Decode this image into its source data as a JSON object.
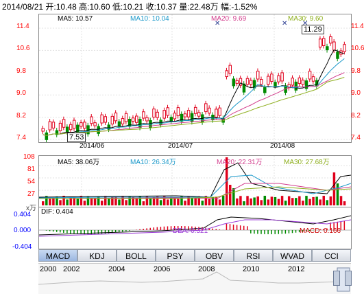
{
  "header": {
    "date": "2014/08/21",
    "open_label": "开:",
    "open": "10.48",
    "high_label": "高:",
    "high": "10.60",
    "low_label": "低:",
    "low": "10.21",
    "close_label": "收:",
    "close": "10.37",
    "vol_label": "量:",
    "vol": "22.48万",
    "chg_label": "幅:",
    "chg": "-1.52%"
  },
  "ma": {
    "ma5": "MA5: 10.57",
    "ma10": "MA10: 10.04",
    "ma20": "MA20: 9.69",
    "ma30": "MA30: 9.60",
    "colors": {
      "ma5": "#000000",
      "ma10": "#1a98c9",
      "ma20": "#d23c8c",
      "ma30": "#8dae1c"
    }
  },
  "price_axis": {
    "left": [
      "11.4",
      "10.6",
      "9.8",
      "9.0",
      "8.2",
      "7.4"
    ],
    "right": [
      "11.4",
      "10.6",
      "9.8",
      "9.0",
      "8.2",
      "7.4"
    ]
  },
  "dates": [
    "2014/06",
    "2014/07",
    "2014/08"
  ],
  "price_markers": {
    "high": "11.29",
    "low": "7.53"
  },
  "volume": {
    "ma5": "MA5: 38.06万",
    "ma10": "MA10: 26.34万",
    "ma20": "MA20: 22.31万",
    "ma30": "MA30: 27.68万",
    "axis": [
      "108",
      "81",
      "54",
      "27"
    ],
    "unit": "x万"
  },
  "macd": {
    "dif": "DIF: 0.404",
    "dea": "DEA: 0.321",
    "macd": "MACD: 0.166",
    "axis": [
      "0.404",
      "0.000",
      "-0.404"
    ]
  },
  "tabs": [
    "MACD",
    "KDJ",
    "BOLL",
    "PSY",
    "OBV",
    "RSI",
    "WVAD",
    "CCI"
  ],
  "timeline_years": [
    "2000",
    "2002",
    "2004",
    "2006",
    "2008",
    "2010",
    "2012"
  ]
}
